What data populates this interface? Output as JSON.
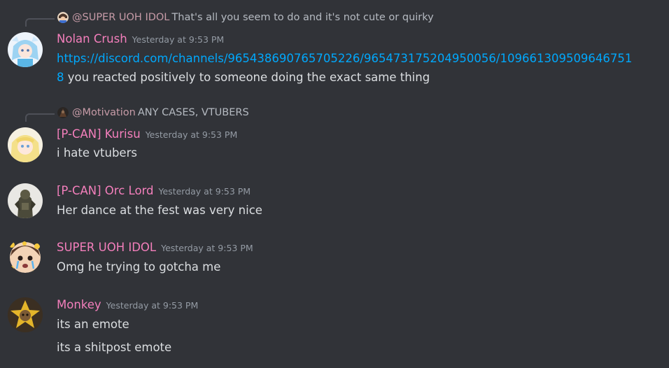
{
  "messages": [
    {
      "reply": {
        "user": "@SUPER UOH IDOL",
        "text": "That's all you seem to do and it's not cute or quirky"
      },
      "username": "Nolan Crush",
      "timestamp": "Yesterday at 9:53 PM",
      "link_line1": "https://discord.com/channels/965438690765705226/965473175204950056/109661309509646751",
      "link_line2": "8",
      "text_after_link": " you reacted positively to someone doing the exact same thing"
    },
    {
      "reply": {
        "user": "@Motivation",
        "text": "ANY CASES, VTUBERS"
      },
      "username": "[P-CAN] Kurisu",
      "timestamp": "Yesterday at 9:53 PM",
      "text": "i hate vtubers"
    },
    {
      "username": "[P-CAN] Orc Lord",
      "timestamp": "Yesterday at 9:53 PM",
      "text": "Her dance at the fest was very nice"
    },
    {
      "username": "SUPER UOH IDOL",
      "timestamp": "Yesterday at 9:53 PM",
      "text": "Omg he trying to gotcha me"
    },
    {
      "username": "Monkey",
      "timestamp": "Yesterday at 9:53 PM",
      "text": "its an emote",
      "text2": "its a shitpost emote"
    }
  ],
  "colors": {
    "background": "#313338",
    "username": "#f47fbc",
    "link": "#00a8fc",
    "timestamp": "#949ba4",
    "text": "#dbdee1"
  }
}
